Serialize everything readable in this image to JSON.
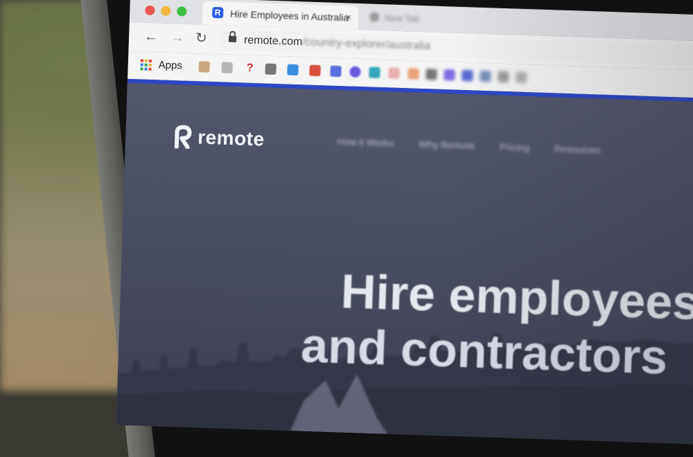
{
  "browser": {
    "window_controls": [
      "close",
      "minimize",
      "zoom"
    ],
    "active_tab": {
      "title": "Hire Employees in Australia",
      "close_label": "×",
      "favicon": "remote-logo-icon"
    },
    "second_tab": {
      "title": "New Tab"
    },
    "nav": {
      "back": "←",
      "forward": "→",
      "reload": "↻"
    },
    "address_bar": {
      "url_domain": "remote.com",
      "url_path": "/country-explorer/australia"
    },
    "bookmarks": {
      "apps_label": "Apps",
      "items": [
        "bookmark-1",
        "bookmark-2",
        "bookmark-3",
        "bookmark-4",
        "bookmark-5",
        "bookmark-6",
        "bookmark-7",
        "bookmark-8",
        "bookmark-9",
        "bookmark-10",
        "bookmark-11",
        "bookmark-12",
        "bookmark-13",
        "bookmark-14",
        "bookmark-15",
        "bookmark-16",
        "bookmark-17"
      ]
    }
  },
  "site": {
    "logo_text": "remote",
    "nav": [
      "How it Works",
      "Why Remote",
      "Pricing",
      "Resources"
    ],
    "hero": {
      "headline_line1": "Hire employees",
      "headline_line2": "and contractors"
    }
  },
  "colors": {
    "accent_bar": "#2e46c5",
    "site_background": "#4b4f63",
    "close_light": "#ee5a52",
    "minimize_light": "#f4b93e",
    "zoom_light": "#3cc245"
  }
}
